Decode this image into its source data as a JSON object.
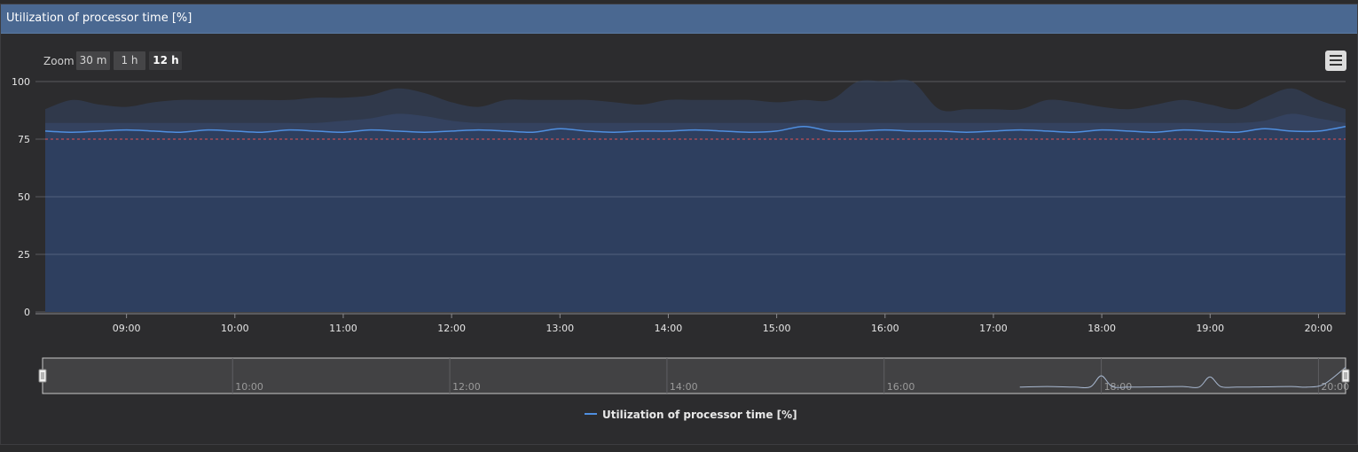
{
  "panel": {
    "title": "Utilization of processor time [%]"
  },
  "zoom": {
    "label": "Zoom",
    "options": [
      {
        "label": "30 m",
        "selected": false
      },
      {
        "label": "1 h",
        "selected": false
      },
      {
        "label": "12 h",
        "selected": true
      }
    ]
  },
  "menu": {
    "icon": "hamburger-menu-icon"
  },
  "colors": {
    "series_line": "#4f8fe0",
    "series_fill": "#2e3f5f",
    "band_fill": "#354565",
    "threshold": "#e05050",
    "background": "#2c2c2e"
  },
  "chart_data": {
    "type": "area",
    "ylim": [
      0,
      100
    ],
    "y_ticks": [
      {
        "value": 0,
        "label": "0"
      },
      {
        "value": 25,
        "label": "25"
      },
      {
        "value": 50,
        "label": "50"
      },
      {
        "value": 75,
        "label": "75"
      },
      {
        "value": 100,
        "label": "100"
      }
    ],
    "xlim": [
      8.25,
      20.25
    ],
    "x_ticks": [
      {
        "value": 9,
        "label": "09:00"
      },
      {
        "value": 10,
        "label": "10:00"
      },
      {
        "value": 11,
        "label": "11:00"
      },
      {
        "value": 12,
        "label": "12:00"
      },
      {
        "value": 13,
        "label": "13:00"
      },
      {
        "value": 14,
        "label": "14:00"
      },
      {
        "value": 15,
        "label": "15:00"
      },
      {
        "value": 16,
        "label": "16:00"
      },
      {
        "value": 17,
        "label": "17:00"
      },
      {
        "value": 18,
        "label": "18:00"
      },
      {
        "value": 19,
        "label": "19:00"
      },
      {
        "value": 20,
        "label": "20:00"
      }
    ],
    "threshold": 75,
    "grid": true,
    "legend": "bottom-center",
    "series": [
      {
        "name": "Utilization of processor time [%]",
        "x": [
          8.25,
          8.5,
          8.75,
          9.0,
          9.25,
          9.5,
          9.75,
          10.0,
          10.25,
          10.5,
          10.75,
          11.0,
          11.25,
          11.5,
          11.75,
          12.0,
          12.25,
          12.5,
          12.75,
          13.0,
          13.25,
          13.5,
          13.75,
          14.0,
          14.25,
          14.5,
          14.75,
          15.0,
          15.25,
          15.5,
          15.75,
          16.0,
          16.25,
          16.5,
          16.75,
          17.0,
          17.25,
          17.5,
          17.75,
          18.0,
          18.25,
          18.5,
          18.75,
          19.0,
          19.25,
          19.5,
          19.75,
          20.0,
          20.25
        ],
        "values": [
          78.5,
          78.0,
          78.5,
          79.0,
          78.5,
          78.0,
          79.0,
          78.5,
          78.0,
          79.0,
          78.5,
          78.0,
          79.0,
          78.5,
          78.0,
          78.5,
          79.0,
          78.5,
          78.0,
          79.5,
          78.5,
          78.0,
          78.5,
          78.5,
          79.0,
          78.5,
          78.0,
          78.5,
          80.5,
          78.5,
          78.5,
          79.0,
          78.5,
          78.5,
          78.0,
          78.5,
          79.0,
          78.5,
          78.0,
          79.0,
          78.5,
          78.0,
          79.0,
          78.5,
          78.0,
          79.5,
          78.5,
          78.5,
          80.5
        ],
        "band_upper": [
          88,
          92,
          90,
          89,
          91,
          92,
          92,
          92,
          92,
          92,
          93,
          93,
          94,
          97,
          95,
          91,
          89,
          92,
          92,
          92,
          92,
          91,
          90,
          92,
          92,
          92,
          92,
          91,
          92,
          92,
          100,
          100,
          100,
          88,
          88,
          88,
          88,
          92,
          91,
          89,
          88,
          90,
          92,
          90,
          88,
          93,
          97,
          92,
          88
        ],
        "band_mid": [
          82,
          82,
          82,
          82,
          82,
          82,
          82,
          82,
          82,
          82,
          82,
          83,
          84,
          86,
          85,
          83,
          82,
          82,
          82,
          82,
          82,
          82,
          82,
          82,
          82,
          82,
          82,
          82,
          82,
          82,
          82,
          82,
          82,
          82,
          82,
          82,
          82,
          82,
          82,
          82,
          82,
          82,
          82,
          82,
          82,
          83,
          86,
          84,
          82
        ]
      }
    ],
    "navigator": {
      "x_ticks": [
        {
          "value": 10,
          "label": "10:00"
        },
        {
          "value": 12,
          "label": "12:00"
        },
        {
          "value": 14,
          "label": "14:00"
        },
        {
          "value": 16,
          "label": "16:00"
        },
        {
          "value": 18,
          "label": "18:00"
        },
        {
          "value": 20,
          "label": "20:00"
        }
      ],
      "xlim": [
        8.25,
        20.25
      ],
      "line_x": [
        17.25,
        17.5,
        17.75,
        17.9,
        18.0,
        18.1,
        18.25,
        18.5,
        18.75,
        18.9,
        19.0,
        19.1,
        19.25,
        19.5,
        19.75,
        19.9,
        20.05,
        20.25
      ],
      "line_y": [
        0.5,
        0.6,
        0.5,
        0.55,
        2.5,
        0.6,
        0.5,
        0.55,
        0.6,
        0.5,
        2.3,
        0.6,
        0.5,
        0.55,
        0.6,
        0.5,
        1.0,
        4.0
      ]
    }
  },
  "legend": {
    "label": "Utilization of processor time [%]"
  }
}
